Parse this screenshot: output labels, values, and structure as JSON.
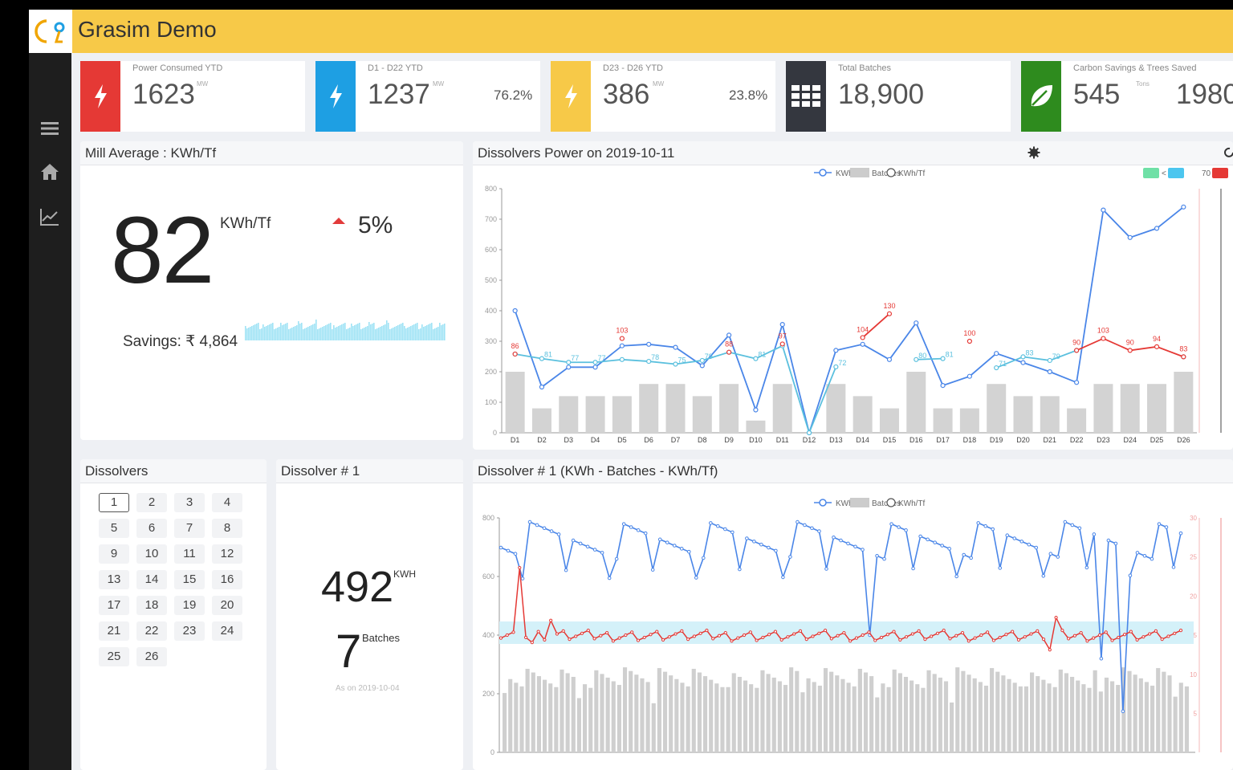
{
  "header": {
    "title": "Grasim Demo"
  },
  "sidebar": {
    "items": [
      "menu",
      "home",
      "trends"
    ]
  },
  "kpis": [
    {
      "label": "Power Consumed YTD",
      "value": "1623",
      "unit": "MW",
      "pct": "",
      "color": "#e53935",
      "icon": "bolt-icon"
    },
    {
      "label": "D1 - D22 YTD",
      "value": "1237",
      "unit": "MW",
      "pct": "76.2%",
      "color": "#1e9fe3",
      "icon": "bolt-icon"
    },
    {
      "label": "D23 - D26 YTD",
      "value": "386",
      "unit": "MW",
      "pct": "23.8%",
      "color": "#f7c948",
      "icon": "bolt-icon"
    },
    {
      "label": "Total Batches",
      "value": "18,900",
      "unit": "",
      "pct": "",
      "color": "#34373f",
      "icon": "grid-icon"
    },
    {
      "label": "Carbon Savings & Trees Saved",
      "value": "545",
      "unit": "Tons",
      "pct": "",
      "extra": "1980",
      "color": "#2e8b1e",
      "icon": "leaf-icon"
    }
  ],
  "mill": {
    "title": "Mill Average : KWh/Tf",
    "value": "82",
    "unit": "KWh/Tf",
    "change": "5%",
    "savings": "Savings: ₹ 4,864"
  },
  "power_panel": {
    "title": "Dissolvers Power on 2019-10-11",
    "legend": [
      "KWh",
      "Batches",
      "KWh/Tf"
    ],
    "band_labels": [
      "<",
      "70"
    ]
  },
  "dissolvers": {
    "title": "Dissolvers",
    "numbers": [
      "1",
      "2",
      "3",
      "4",
      "5",
      "6",
      "7",
      "8",
      "9",
      "10",
      "11",
      "12",
      "13",
      "14",
      "15",
      "16",
      "17",
      "18",
      "19",
      "20",
      "21",
      "22",
      "23",
      "24",
      "25",
      "26"
    ],
    "selected": "1"
  },
  "dissolver1": {
    "title": "Dissolver # 1",
    "kwh": "492",
    "kwh_unit": "KWH",
    "batches": "7",
    "batches_unit": "Batches",
    "as_on": "As on 2019-10-04"
  },
  "history_panel": {
    "title": "Dissolver # 1 (KWh - Batches - KWh/Tf)",
    "legend": [
      "KWh",
      "Batches",
      "KWh/Tf"
    ]
  },
  "chart_data": [
    {
      "type": "line",
      "title": "Dissolvers Power on 2019-10-11",
      "categories": [
        "D1",
        "D2",
        "D3",
        "D4",
        "D5",
        "D6",
        "D7",
        "D8",
        "D9",
        "D10",
        "D11",
        "D12",
        "D13",
        "D14",
        "D15",
        "D16",
        "D17",
        "D18",
        "D19",
        "D20",
        "D21",
        "D22",
        "D23",
        "D24",
        "D25",
        "D26"
      ],
      "y_ticks": [
        "0",
        "100",
        "200",
        "300",
        "400",
        "500",
        "600",
        "700",
        "800"
      ],
      "ylim": [
        0,
        800
      ],
      "series": [
        {
          "name": "KWh",
          "color": "#4a86e8",
          "values": [
            400,
            150,
            215,
            215,
            285,
            290,
            280,
            220,
            320,
            75,
            355,
            0,
            270,
            290,
            240,
            360,
            155,
            185,
            260,
            230,
            200,
            165,
            730,
            640,
            670,
            740
          ]
        },
        {
          "name": "Batches",
          "color": "#cccccc",
          "values": [
            200,
            80,
            120,
            120,
            120,
            160,
            160,
            120,
            160,
            40,
            160,
            0,
            160,
            120,
            80,
            200,
            80,
            80,
            160,
            120,
            120,
            80,
            160,
            160,
            160,
            200
          ]
        },
        {
          "name": "KWh/Tf",
          "color": "#e53935",
          "values": [
            86,
            null,
            null,
            null,
            103,
            null,
            null,
            null,
            88,
            null,
            97,
            null,
            null,
            104,
            130,
            null,
            null,
            100,
            null,
            null,
            null,
            90,
            103,
            90,
            94,
            83
          ]
        },
        {
          "name": "KWh/Tf",
          "color": "#5bc0de",
          "values": [
            86,
            81,
            77,
            77,
            80,
            78,
            75,
            79,
            88,
            81,
            95,
            0,
            72,
            null,
            null,
            80,
            81,
            null,
            71,
            83,
            79,
            90,
            null,
            null,
            null,
            83
          ]
        }
      ],
      "labels_red": [
        "86",
        "103",
        "88",
        "97",
        "104",
        "130",
        "100",
        "90",
        "103",
        "90",
        "94",
        "83"
      ],
      "labels_blue": [
        "81",
        "77",
        "77",
        "78",
        "75",
        "79",
        "81",
        "72",
        "80",
        "81",
        "71",
        "83",
        "79"
      ]
    },
    {
      "type": "line",
      "title": "Dissolver # 1 (KWh - Batches - KWh/Tf)",
      "y_ticks": [
        "0",
        "200",
        "400",
        "600",
        "800"
      ],
      "y2_ticks": [
        "30",
        "25",
        "20",
        "15",
        "10",
        "5"
      ],
      "ylim": [
        0,
        800
      ]
    }
  ]
}
